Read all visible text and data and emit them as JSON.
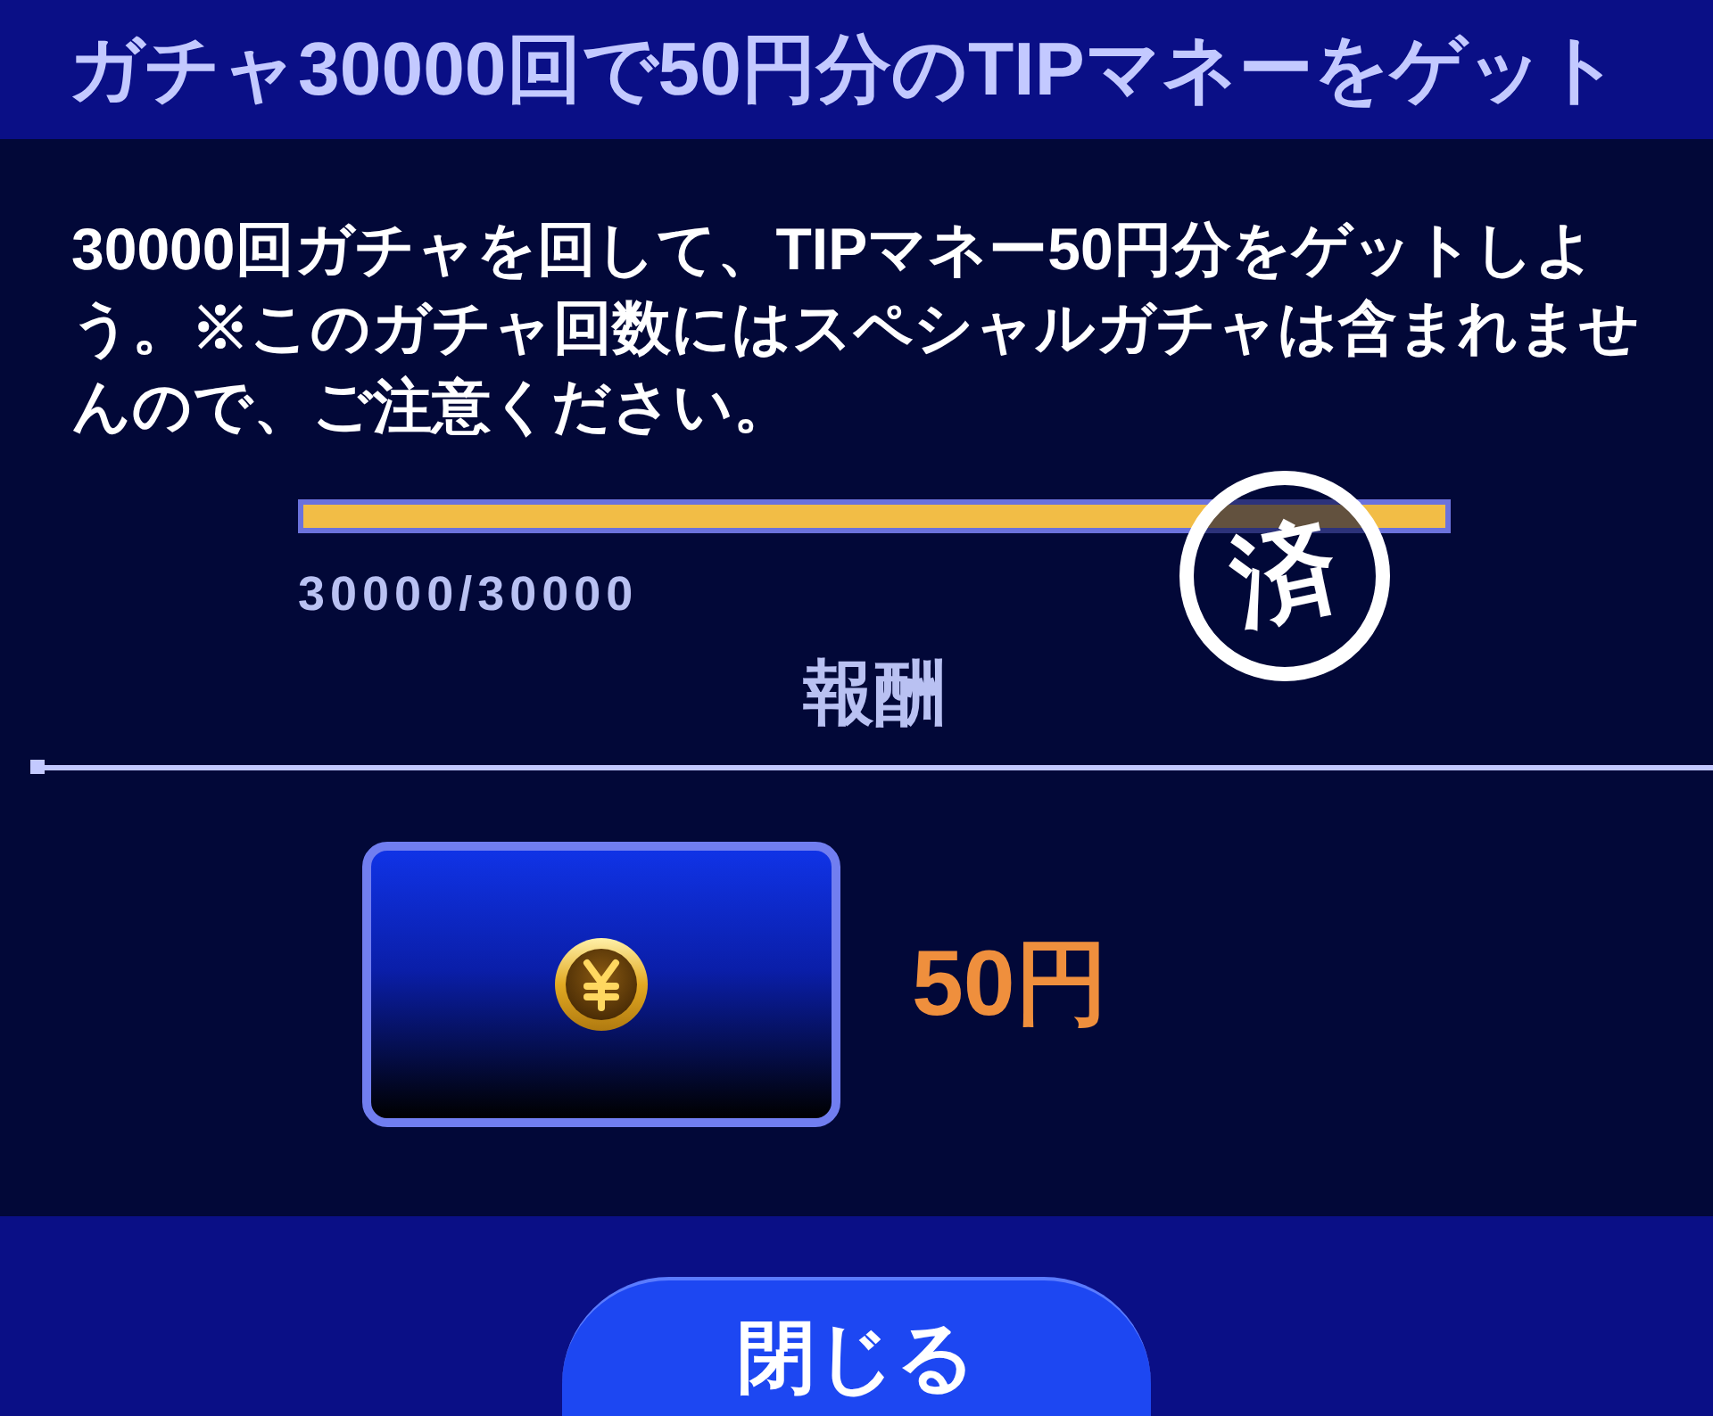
{
  "header": {
    "title": "ガチャ30000回で50円分のTIPマネーをゲット"
  },
  "mission": {
    "description": "30000回ガチャを回して、TIPマネー50円分をゲットしよう。※このガチャ回数にはスペシャルガチャは含まれませんので、ご注意ください。",
    "progress": {
      "level": 1,
      "reading": "30000/30000"
    },
    "completed": true,
    "stamp": "済"
  },
  "rewards": {
    "heading": "報酬",
    "items": [
      {
        "amount": "50円"
      }
    ]
  },
  "footer": {
    "buttons": [
      {
        "label": "閉じる"
      }
    ]
  }
}
